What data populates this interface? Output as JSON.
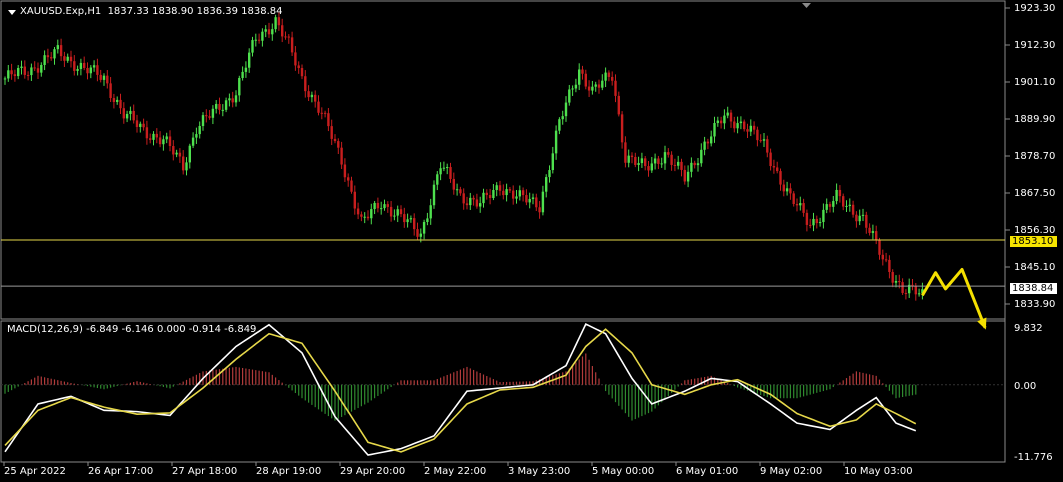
{
  "header": {
    "symbol_timeframe": "XAUUSD.Exp,H1",
    "ohlc": "1837.33 1838.90 1836.39 1838.84"
  },
  "price_axis": {
    "labels": [
      "1923.30",
      "1912.30",
      "1901.10",
      "1889.90",
      "1878.70",
      "1867.50",
      "1856.30",
      "1845.10",
      "1833.90"
    ],
    "level_line_value": "1853.10",
    "current_price": "1838.84"
  },
  "macd": {
    "title": "MACD(12,26,9) -6.849 -6.146 0.000 -0.914 -6.849",
    "axis_labels": [
      "9.832",
      "0.00",
      "-11.776"
    ]
  },
  "time_axis": {
    "labels": [
      "25 Apr 2022",
      "26 Apr 17:00",
      "27 Apr 18:00",
      "28 Apr 19:00",
      "29 Apr 20:00",
      "2 May 22:00",
      "3 May 23:00",
      "5 May 00:00",
      "6 May 01:00",
      "9 May 02:00",
      "10 May 03:00"
    ]
  },
  "colors": {
    "background": "#000000",
    "bull_candle": "#4ee04e",
    "bear_candle": "#c81e1e",
    "level_line": "#e6d84a",
    "current_price_bg": "#ffffff",
    "level_bg": "#f7e500",
    "macd_main": "#ffffff",
    "macd_signal": "#e6d84a",
    "hist_positive": "#b23b3b",
    "hist_negative": "#2f8a2f",
    "forecast_arrow": "#f5e000"
  },
  "chart_data": {
    "type": "candlestick",
    "instrument": "XAUUSD.Exp",
    "timeframe": "H1",
    "close_path": [
      [
        0,
        1903
      ],
      [
        8,
        1906
      ],
      [
        16,
        1911
      ],
      [
        24,
        1906
      ],
      [
        30,
        1903
      ],
      [
        36,
        1892
      ],
      [
        42,
        1887
      ],
      [
        48,
        1884
      ],
      [
        54,
        1876
      ],
      [
        58,
        1888
      ],
      [
        64,
        1893
      ],
      [
        70,
        1899
      ],
      [
        76,
        1915
      ],
      [
        82,
        1921
      ],
      [
        86,
        1913
      ],
      [
        90,
        1903
      ],
      [
        96,
        1892
      ],
      [
        102,
        1878
      ],
      [
        108,
        1858
      ],
      [
        114,
        1865
      ],
      [
        120,
        1860
      ],
      [
        126,
        1855
      ],
      [
        132,
        1876
      ],
      [
        138,
        1867
      ],
      [
        144,
        1864
      ],
      [
        150,
        1870
      ],
      [
        156,
        1866
      ],
      [
        162,
        1864
      ],
      [
        168,
        1889
      ],
      [
        174,
        1906
      ],
      [
        178,
        1899
      ],
      [
        184,
        1904
      ],
      [
        188,
        1879
      ],
      [
        194,
        1875
      ],
      [
        200,
        1880
      ],
      [
        206,
        1872
      ],
      [
        212,
        1883
      ],
      [
        218,
        1891
      ],
      [
        224,
        1889
      ],
      [
        230,
        1882
      ],
      [
        238,
        1866
      ],
      [
        244,
        1858
      ],
      [
        252,
        1866
      ],
      [
        260,
        1860
      ],
      [
        266,
        1847
      ],
      [
        272,
        1838
      ],
      [
        278,
        1836
      ]
    ],
    "level_line": 1853.1,
    "current_price": 1838.84,
    "forecast_path": [
      [
        278,
        1836
      ],
      [
        282,
        1843
      ],
      [
        285,
        1838
      ],
      [
        290,
        1844
      ],
      [
        297,
        1826
      ]
    ],
    "ylim": [
      1829,
      1926
    ],
    "macd_ylim": [
      -11.776,
      9.832
    ],
    "macd_path": [
      [
        0,
        -10.5
      ],
      [
        10,
        -3
      ],
      [
        20,
        -1.8
      ],
      [
        30,
        -4
      ],
      [
        40,
        -4.2
      ],
      [
        50,
        -4.8
      ],
      [
        60,
        1
      ],
      [
        70,
        6
      ],
      [
        80,
        9.4
      ],
      [
        90,
        5
      ],
      [
        100,
        -5
      ],
      [
        110,
        -11
      ],
      [
        120,
        -10
      ],
      [
        130,
        -8
      ],
      [
        140,
        -1
      ],
      [
        150,
        -0.5
      ],
      [
        160,
        0
      ],
      [
        170,
        3
      ],
      [
        176,
        9.5
      ],
      [
        182,
        8
      ],
      [
        190,
        1
      ],
      [
        196,
        -3
      ],
      [
        206,
        -1
      ],
      [
        214,
        1
      ],
      [
        222,
        0.5
      ],
      [
        232,
        -3
      ],
      [
        240,
        -6
      ],
      [
        250,
        -7
      ],
      [
        258,
        -4
      ],
      [
        264,
        -2
      ],
      [
        270,
        -6
      ],
      [
        276,
        -7.2
      ]
    ],
    "signal_path": [
      [
        0,
        -9.5
      ],
      [
        10,
        -4
      ],
      [
        20,
        -2
      ],
      [
        30,
        -3.5
      ],
      [
        40,
        -4.6
      ],
      [
        50,
        -4.4
      ],
      [
        60,
        -0.5
      ],
      [
        70,
        4
      ],
      [
        80,
        8
      ],
      [
        90,
        6.5
      ],
      [
        100,
        -1
      ],
      [
        110,
        -9
      ],
      [
        120,
        -10.5
      ],
      [
        130,
        -8.5
      ],
      [
        140,
        -3
      ],
      [
        150,
        -0.8
      ],
      [
        160,
        -0.4
      ],
      [
        170,
        1.5
      ],
      [
        176,
        6
      ],
      [
        182,
        8.7
      ],
      [
        190,
        5
      ],
      [
        196,
        0
      ],
      [
        206,
        -1.5
      ],
      [
        214,
        0
      ],
      [
        222,
        0.8
      ],
      [
        232,
        -1.5
      ],
      [
        240,
        -4.5
      ],
      [
        250,
        -6.5
      ],
      [
        258,
        -5.5
      ],
      [
        264,
        -3
      ],
      [
        270,
        -4.5
      ],
      [
        276,
        -6.1
      ]
    ]
  }
}
